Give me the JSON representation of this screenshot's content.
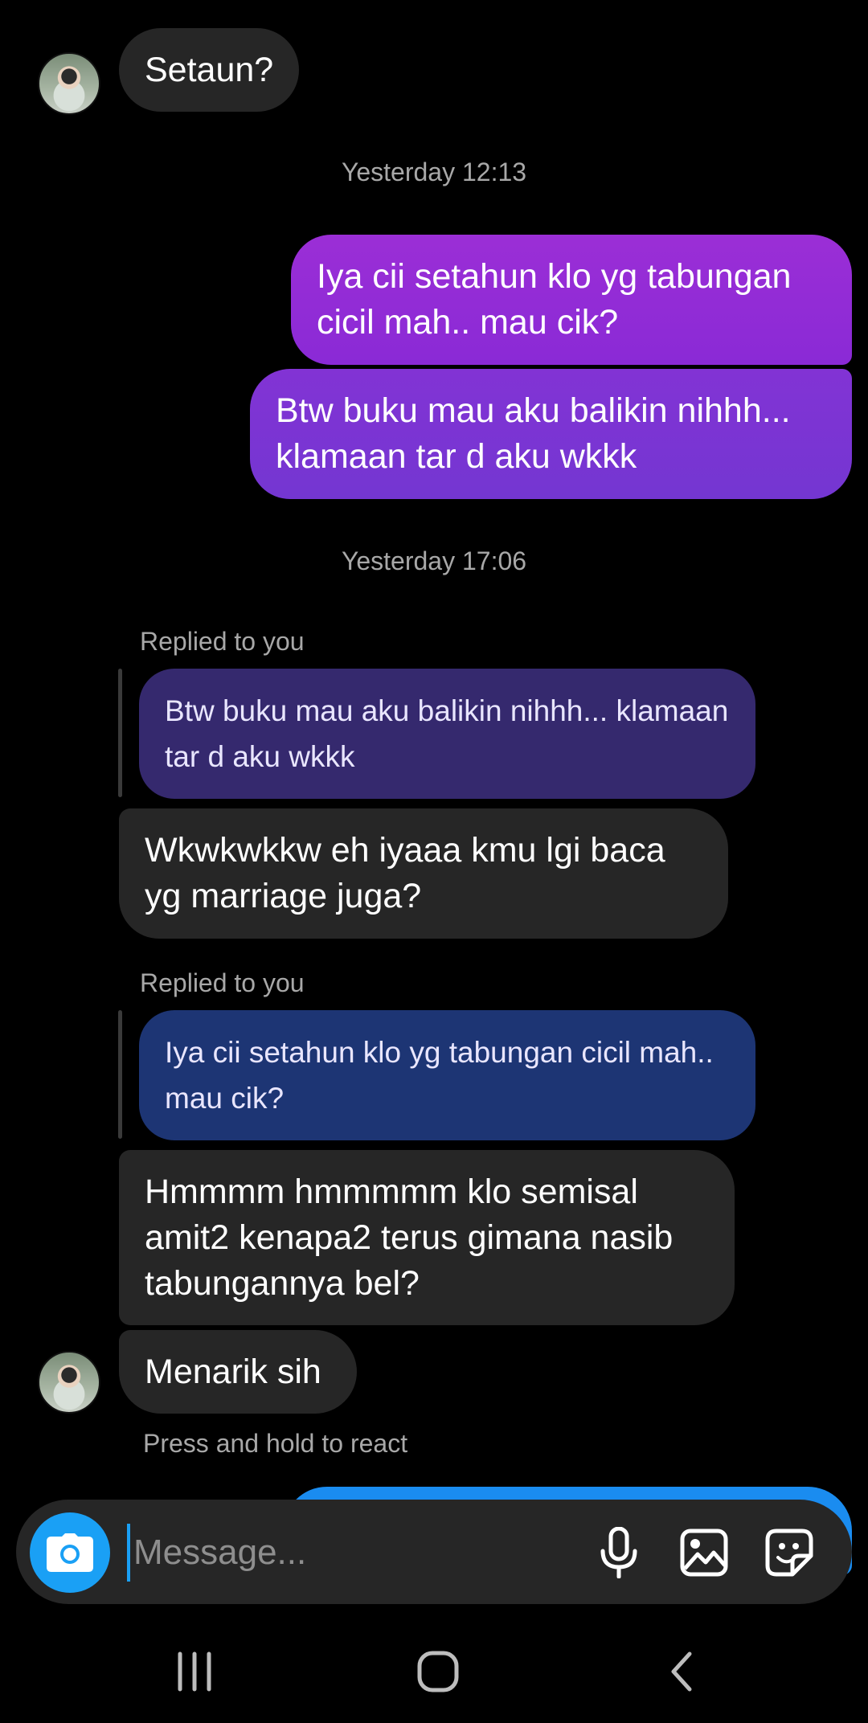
{
  "messages": {
    "m1": "Setaun?",
    "ts1": "Yesterday 12:13",
    "m2": "Iya cii setahun klo yg tabungan cicil mah.. mau cik?",
    "m3": "Btw buku mau aku balikin nihhh... klamaan tar d aku wkkk",
    "ts2": "Yesterday 17:06",
    "reply1_label": "Replied to you",
    "reply1_quote": "Btw buku mau aku balikin nihhh... klamaan tar d aku wkkk",
    "m4": "Wkwkwkkw eh iyaaa kmu lgi baca yg marriage juga?",
    "reply2_label": "Replied to you",
    "reply2_quote": "Iya cii setahun klo yg tabungan cicil mah.. mau cik?",
    "m5": "Hmmmm hmmmmm klo semisal amit2 kenapa2 terus gimana nasib tabungannya bel?",
    "m6": "Menarik sih",
    "hint": "Press and hold to react"
  },
  "composer": {
    "placeholder": "Message...",
    "icons": [
      "camera-icon",
      "microphone-icon",
      "gallery-icon",
      "sticker-icon"
    ]
  },
  "navbar": {
    "icons": [
      "recent-apps-icon",
      "home-icon",
      "back-icon"
    ]
  },
  "colors": {
    "incoming_bubble": "#262626",
    "outgoing_purple_1": "#9b2ed6",
    "outgoing_purple_2": "#7d35d2",
    "reply_quote_1": "#35296e",
    "reply_quote_2": "#1d3574",
    "accent_blue": "#1aa0f5"
  }
}
